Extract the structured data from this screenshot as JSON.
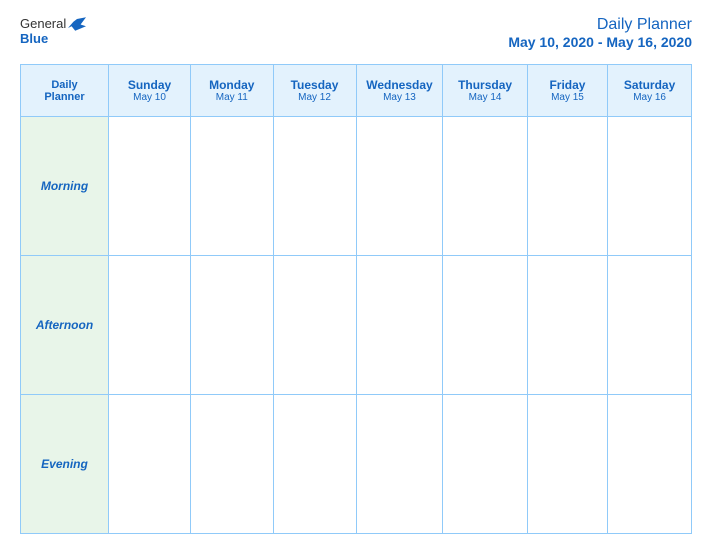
{
  "logo": {
    "general": "General",
    "blue": "Blue",
    "bird_unicode": "🐦"
  },
  "title": {
    "main": "Daily Planner",
    "dates": "May 10, 2020 - May 16, 2020"
  },
  "corner": {
    "line1": "Daily",
    "line2": "Planner"
  },
  "days": [
    {
      "name": "Sunday",
      "date": "May 10"
    },
    {
      "name": "Monday",
      "date": "May 11"
    },
    {
      "name": "Tuesday",
      "date": "May 12"
    },
    {
      "name": "Wednesday",
      "date": "May 13"
    },
    {
      "name": "Thursday",
      "date": "May 14"
    },
    {
      "name": "Friday",
      "date": "May 15"
    },
    {
      "name": "Saturday",
      "date": "May 16"
    }
  ],
  "rows": [
    {
      "label": "Morning"
    },
    {
      "label": "Afternoon"
    },
    {
      "label": "Evening"
    }
  ]
}
